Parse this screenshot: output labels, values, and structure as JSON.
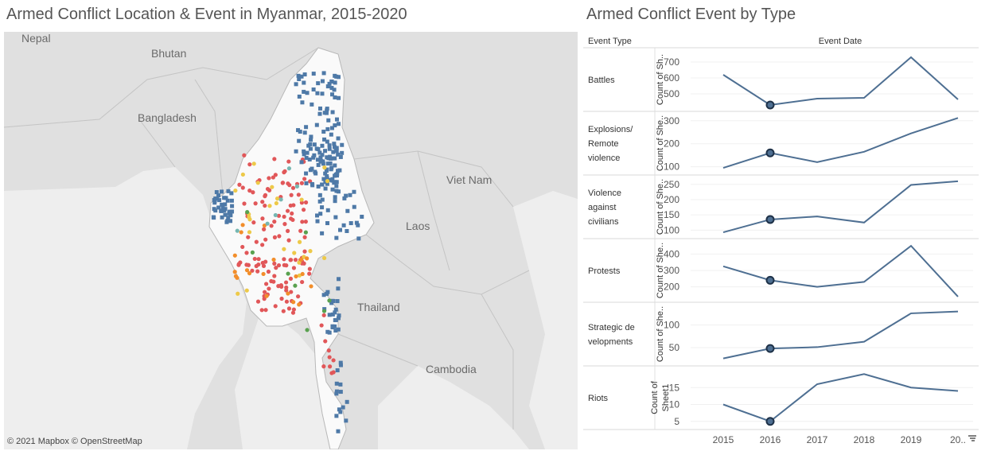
{
  "map": {
    "title": "Armed Conflict Location & Event in Myanmar, 2015-2020",
    "attribution": "© 2021 Mapbox  © OpenStreetMap",
    "labels": {
      "nepal": "Nepal",
      "bhutan": "Bhutan",
      "bangladesh": "Bangladesh",
      "vietnam": "Viet Nam",
      "laos": "Laos",
      "thailand": "Thailand",
      "cambodia": "Cambodia"
    },
    "colors": {
      "land": "#e0e0e0",
      "myanmar": "#fafafa",
      "sea": "#eeeeee",
      "battles": "#4e79a7",
      "explosions": "#f28e2b",
      "violence": "#e15759",
      "protests": "#edc948",
      "strategic": "#59a14f",
      "riots": "#76b7b2"
    }
  },
  "chart": {
    "title": "Armed Conflict Event by Type",
    "row_header": "Event Type",
    "column_header": "Event Date",
    "line_color": "#4e6f92",
    "highlight_color": "#1e3148",
    "sort_icon": "sort-descending-icon"
  },
  "chart_data": {
    "type": "line",
    "x": [
      "2015",
      "2016",
      "2017",
      "2018",
      "2019",
      "20.."
    ],
    "highlight_x": "2016",
    "series": [
      {
        "name": "Battles",
        "label_lines": [
          "Battles"
        ],
        "ylabel": "Count of Sh..",
        "values": [
          620,
          430,
          470,
          475,
          730,
          465
        ],
        "ylim": [
          420,
          760
        ],
        "ticks": [
          500,
          600,
          700
        ]
      },
      {
        "name": "Explosions/ Remote violence",
        "label_lines": [
          "Explosions/",
          "Remote",
          "violence"
        ],
        "ylabel": "Count of She..",
        "values": [
          95,
          160,
          120,
          165,
          245,
          312
        ],
        "ylim": [
          85,
          320
        ],
        "ticks": [
          100,
          200,
          300
        ]
      },
      {
        "name": "Violence against civilians",
        "label_lines": [
          "Violence",
          "against",
          "civilians"
        ],
        "ylabel": "Count of She..",
        "values": [
          93,
          135,
          145,
          125,
          248,
          260
        ],
        "ylim": [
          88,
          265
        ],
        "ticks": [
          100,
          150,
          200,
          250
        ]
      },
      {
        "name": "Protests",
        "label_lines": [
          "Protests"
        ],
        "ylabel": "Count of She..",
        "values": [
          325,
          240,
          200,
          230,
          450,
          140
        ],
        "ylim": [
          135,
          465
        ],
        "ticks": [
          200,
          300,
          400
        ]
      },
      {
        "name": "Strategic developments",
        "label_lines": [
          "Strategic de",
          "velopments"
        ],
        "ylabel": "Count of She..",
        "values": [
          26,
          48,
          51,
          63,
          126,
          130
        ],
        "ylim": [
          20,
          140
        ],
        "ticks": [
          50,
          100
        ]
      },
      {
        "name": "Riots",
        "label_lines": [
          "Riots"
        ],
        "ylabel_lines": [
          "Count of",
          "Sheet1"
        ],
        "ylabel": "Count of Sheet1",
        "values": [
          10,
          5,
          16,
          19,
          15,
          14
        ],
        "ylim": [
          4,
          20
        ],
        "ticks": [
          5,
          10,
          15
        ]
      }
    ]
  }
}
